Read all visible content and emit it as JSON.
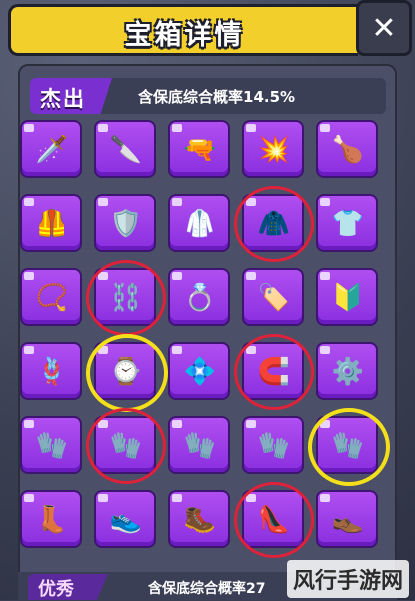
{
  "header": {
    "title": "宝箱详情",
    "close_label": "✕"
  },
  "category": {
    "name": "杰出",
    "info": "含保底综合概率14.5%"
  },
  "footer": {
    "name": "优秀",
    "info": "含保底综合概率27"
  },
  "watermark": "风行手游网",
  "grid": {
    "rows": [
      [
        "🗡️",
        "🔪",
        "🔫",
        "💥",
        "🍗"
      ],
      [
        "🦺",
        "🛡️",
        "🥼",
        "🧥",
        "👕"
      ],
      [
        "📿",
        "⛓️",
        "💍",
        "🏷️",
        "🔰"
      ],
      [
        "🪢",
        "⌚",
        "💠",
        "🧲",
        "⚙️"
      ],
      [
        "🧤",
        "🧤",
        "🧤",
        "🧤",
        "🧤"
      ],
      [
        "👢",
        "👟",
        "🥾",
        "👠",
        "👞"
      ]
    ],
    "annotations": [
      {
        "row": 1,
        "col": 3,
        "color": "red"
      },
      {
        "row": 2,
        "col": 1,
        "color": "red"
      },
      {
        "row": 3,
        "col": 1,
        "color": "yellow"
      },
      {
        "row": 3,
        "col": 3,
        "color": "red"
      },
      {
        "row": 4,
        "col": 1,
        "color": "red"
      },
      {
        "row": 4,
        "col": 4,
        "color": "yellow"
      },
      {
        "row": 5,
        "col": 3,
        "color": "red"
      }
    ]
  }
}
